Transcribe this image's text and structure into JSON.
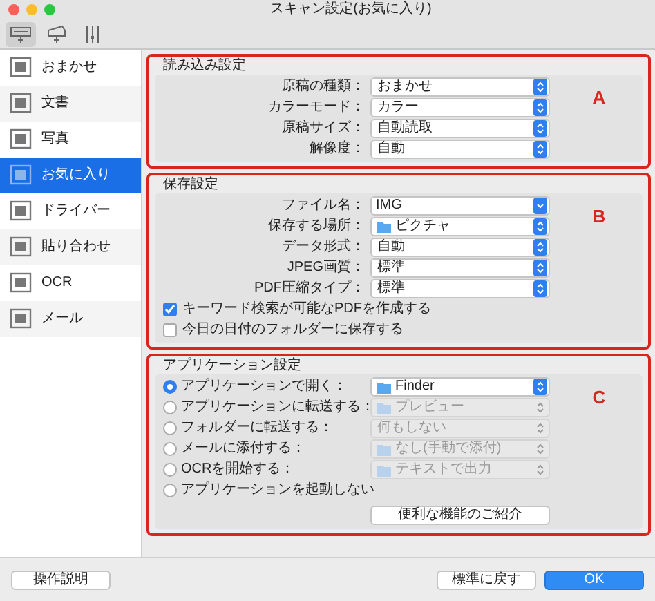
{
  "window": {
    "title": "スキャン設定(お気に入り)"
  },
  "toolbar": [
    {
      "selected": true
    },
    {
      "selected": false
    },
    {
      "selected": false
    }
  ],
  "sidebar": {
    "items": [
      {
        "label": "おまかせ",
        "selected": false
      },
      {
        "label": "文書",
        "selected": false
      },
      {
        "label": "写真",
        "selected": false
      },
      {
        "label": "お気に入り",
        "selected": true
      },
      {
        "label": "ドライバー",
        "selected": false
      },
      {
        "label": "貼り合わせ",
        "selected": false
      },
      {
        "label": "OCR",
        "selected": false
      },
      {
        "label": "メール",
        "selected": false
      }
    ]
  },
  "sections": [
    {
      "title": "読み込み設定",
      "annotation": "A",
      "rows": [
        {
          "kind": "popup",
          "label": "原稿の種類：",
          "value": "おまかせ",
          "icon": false,
          "disabled": false
        },
        {
          "kind": "popup",
          "label": "カラーモード：",
          "value": "カラー",
          "icon": false,
          "disabled": false
        },
        {
          "kind": "popup",
          "label": "原稿サイズ：",
          "value": "自動読取",
          "icon": false,
          "disabled": false
        },
        {
          "kind": "popup",
          "label": "解像度：",
          "value": "自動",
          "icon": false,
          "disabled": false
        }
      ]
    },
    {
      "title": "保存設定",
      "annotation": "B",
      "rows": [
        {
          "kind": "combo",
          "label": "ファイル名：",
          "value": "IMG"
        },
        {
          "kind": "popup",
          "label": "保存する場所：",
          "value": "ピクチャ",
          "icon": true,
          "disabled": false
        },
        {
          "kind": "popup",
          "label": "データ形式：",
          "value": "自動",
          "icon": false,
          "disabled": false
        },
        {
          "kind": "popup",
          "label": "JPEG画質：",
          "value": "標準",
          "icon": false,
          "disabled": false
        },
        {
          "kind": "popup",
          "label": "PDF圧縮タイプ：",
          "value": "標準",
          "icon": false,
          "disabled": false
        },
        {
          "kind": "checkbox",
          "label": "キーワード検索が可能なPDFを作成する",
          "checked": true
        },
        {
          "kind": "checkbox",
          "label": "今日の日付のフォルダーに保存する",
          "checked": false
        }
      ]
    },
    {
      "title": "アプリケーション設定",
      "annotation": "C",
      "rows": [
        {
          "kind": "radio",
          "label": "アプリケーションで開く：",
          "selected": true,
          "value": "Finder",
          "icon": true,
          "disabled": false
        },
        {
          "kind": "radio",
          "label": "アプリケーションに転送する：",
          "selected": false,
          "value": "プレビュー",
          "icon": true,
          "disabled": true
        },
        {
          "kind": "radio",
          "label": "フォルダーに転送する：",
          "selected": false,
          "value": "何もしない",
          "icon": false,
          "disabled": true
        },
        {
          "kind": "radio",
          "label": "メールに添付する：",
          "selected": false,
          "value": "なし(手動で添付)",
          "icon": true,
          "disabled": true
        },
        {
          "kind": "radio",
          "label": "OCRを開始する：",
          "selected": false,
          "value": "テキストで出力",
          "icon": true,
          "disabled": true
        },
        {
          "kind": "radio",
          "label": "アプリケーションを起動しない",
          "selected": false
        },
        {
          "kind": "button",
          "label": "便利な機能のご紹介"
        }
      ]
    }
  ],
  "footer": {
    "help_button": "操作説明",
    "reset_button": "標準に戻す",
    "ok_button": "OK"
  }
}
